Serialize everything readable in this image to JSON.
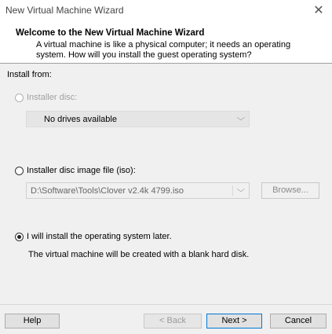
{
  "window": {
    "title": "New Virtual Machine Wizard",
    "close_glyph": "✕"
  },
  "header": {
    "title": "Welcome to the New Virtual Machine Wizard",
    "description": "A virtual machine is like a physical computer; it needs an operating system. How will you install the guest operating system?"
  },
  "install_from": {
    "label": "Install from:",
    "installer_disc": {
      "label": "Installer disc:",
      "selected": false,
      "enabled": false,
      "dropdown_value": "No drives available"
    },
    "iso": {
      "label": "Installer disc image file (iso):",
      "selected": false,
      "enabled": true,
      "path_value": "D:\\Software\\Tools\\Clover v2.4k 4799.iso",
      "browse_label": "Browse..."
    },
    "later": {
      "label": "I will install the operating system later.",
      "selected": true,
      "description": "The virtual machine will be created with a blank hard disk."
    }
  },
  "footer": {
    "help_label": "Help",
    "back_label": "< Back",
    "next_label": "Next >",
    "cancel_label": "Cancel"
  },
  "icons": {
    "chevron": "chevron-down-icon",
    "close": "close-icon"
  }
}
